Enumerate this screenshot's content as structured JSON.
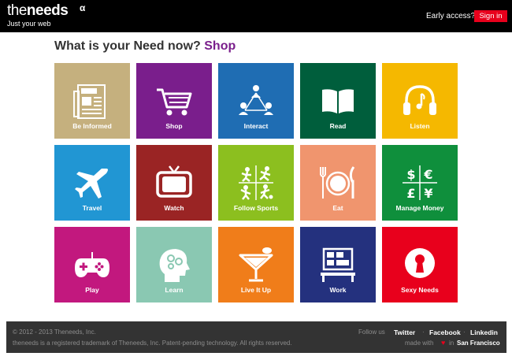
{
  "header": {
    "logo_thin": "the",
    "logo_bold": "needs",
    "logo_alpha": "α",
    "tagline": "Just your web",
    "early_access": "Early access?",
    "signin_label": "Sign in"
  },
  "headline": {
    "question": "What is your Need now?",
    "current": "Shop"
  },
  "tiles": [
    {
      "label": "Be Informed",
      "icon": "newspaper-icon",
      "color": "#c5b07e"
    },
    {
      "label": "Shop",
      "icon": "shopping-cart-icon",
      "color": "#7a1e8c"
    },
    {
      "label": "Interact",
      "icon": "social-network-icon",
      "color": "#1f6db3"
    },
    {
      "label": "Read",
      "icon": "open-book-icon",
      "color": "#005e3c"
    },
    {
      "label": "Listen",
      "icon": "headphones-icon",
      "color": "#f5b800"
    },
    {
      "label": "Travel",
      "icon": "airplane-icon",
      "color": "#2196d3"
    },
    {
      "label": "Watch",
      "icon": "television-icon",
      "color": "#9a2424"
    },
    {
      "label": "Follow Sports",
      "icon": "sports-icon",
      "color": "#8cbf1f"
    },
    {
      "label": "Eat",
      "icon": "plate-cutlery-icon",
      "color": "#f0956e"
    },
    {
      "label": "Manage Money",
      "icon": "currency-icon",
      "color": "#0f8f3c"
    },
    {
      "label": "Play",
      "icon": "gamepad-icon",
      "color": "#c2187e"
    },
    {
      "label": "Learn",
      "icon": "brain-head-icon",
      "color": "#8ac8b2"
    },
    {
      "label": "Live It Up",
      "icon": "cocktail-icon",
      "color": "#f07d1a"
    },
    {
      "label": "Work",
      "icon": "desk-computer-icon",
      "color": "#24317e"
    },
    {
      "label": "Sexy Needs",
      "icon": "keyhole-icon",
      "color": "#e8001c"
    }
  ],
  "footer": {
    "copyright": "© 2012 - 2013 Theneeds, Inc.",
    "trademark": "theneeds is a registered trademark of Theneeds, Inc. Patent-pending technology. All rights reserved.",
    "follow_us": "Follow us",
    "links": [
      "Twitter",
      "Facebook",
      "Linkedin"
    ],
    "separator": "·",
    "made_with": "made with",
    "heart": "♥",
    "in": "in",
    "city": "San Francisco"
  }
}
